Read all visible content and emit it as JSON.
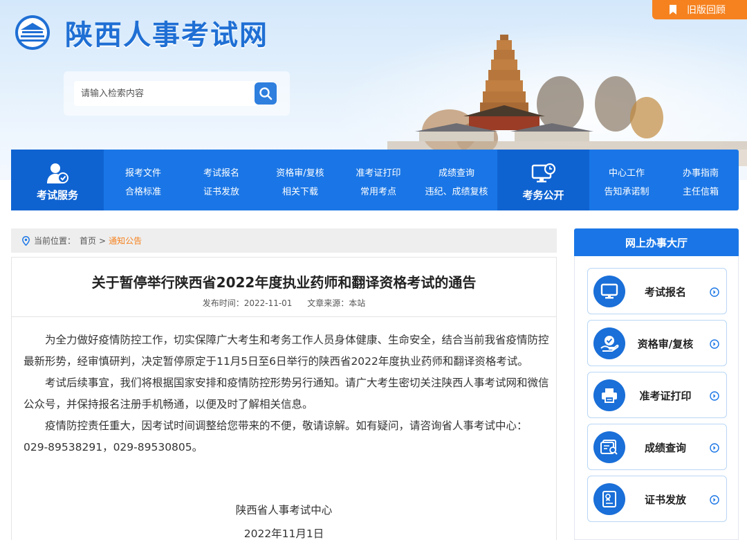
{
  "header": {
    "site_title": "陕西人事考试网",
    "old_version": "旧版回顾",
    "search_placeholder": "请输入检索内容"
  },
  "nav": {
    "service_label": "考试服务",
    "open_label": "考务公开",
    "items": [
      {
        "label": "报考文件"
      },
      {
        "label": "合格标准"
      },
      {
        "label": "考试报名"
      },
      {
        "label": "证书发放"
      },
      {
        "label": "资格审/复核"
      },
      {
        "label": "相关下载"
      },
      {
        "label": "准考证打印"
      },
      {
        "label": "常用考点"
      },
      {
        "label": "成绩查询"
      },
      {
        "label": "违纪、成绩复核"
      },
      {
        "label": "中心工作"
      },
      {
        "label": "告知承诺制"
      },
      {
        "label": "办事指南"
      },
      {
        "label": "主任信箱"
      }
    ]
  },
  "breadcrumb": {
    "prefix": "当前位置：",
    "home": "首页",
    "sep": ">",
    "current": "通知公告"
  },
  "article": {
    "title": "关于暂停举行陕西省2022年度执业药师和翻译资格考试的通告",
    "publish_time": "发布时间：2022-11-01",
    "source": "文章来源：本站",
    "paragraphs": [
      "为全力做好疫情防控工作，切实保障广大考生和考务工作人员身体健康、生命安全，结合当前我省疫情防控最新形势，经审慎研判，决定暂停原定于11月5日至6日举行的陕西省2022年度执业药师和翻译资格考试。",
      "考试后续事宜，我们将根据国家安排和疫情防控形势另行通知。请广大考生密切关注陕西人事考试网和微信公众号，并保持报名注册手机畅通，以便及时了解相关信息。",
      "疫情防控责任重大，因考试时间调整给您带来的不便，敬请谅解。如有疑问，请咨询省人事考试中心：029-89538291，029-89530805。"
    ],
    "signature": "陕西省人事考试中心",
    "date": "2022年11月1日"
  },
  "sidebar": {
    "title": "网上办事大厅",
    "items": [
      {
        "label": "考试报名",
        "icon": "monitor-icon"
      },
      {
        "label": "资格审/复核",
        "icon": "hand-check-icon"
      },
      {
        "label": "准考证打印",
        "icon": "printer-icon"
      },
      {
        "label": "成绩查询",
        "icon": "score-search-icon"
      },
      {
        "label": "证书发放",
        "icon": "certificate-icon"
      }
    ]
  },
  "colors": {
    "primary": "#1a76e6",
    "accent": "#f6821f"
  }
}
